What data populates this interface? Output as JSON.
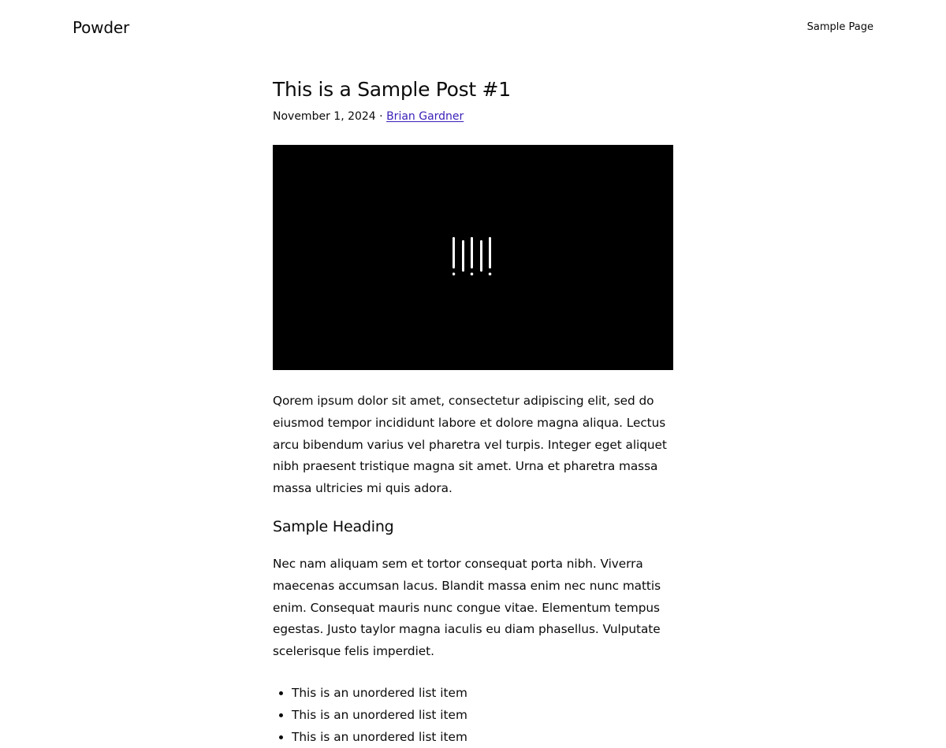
{
  "header": {
    "site_title": "Powder",
    "nav": [
      {
        "label": "Sample Page"
      }
    ]
  },
  "post": {
    "title": "This is a Sample Post #1",
    "date": "November 1, 2024",
    "separator": "·",
    "author": "Brian Gardner",
    "featured_image": {
      "icon": "barcode-logo-icon"
    },
    "paragraph_1": "Qorem ipsum dolor sit amet, consectetur adipiscing elit, sed do eiusmod tempor incididunt labore et dolore magna aliqua. Lectus arcu bibendum varius vel pharetra vel turpis. Integer eget aliquet nibh praesent tristique magna sit amet. Urna et pharetra massa massa ultricies mi quis adora.",
    "heading": "Sample Heading",
    "paragraph_2": "Nec nam aliquam sem et tortor consequat porta nibh. Viverra maecenas accumsan lacus. Blandit massa enim nec nunc mattis enim. Consequat mauris nunc congue vitae. Elementum tempus egestas. Justo taylor magna iaculis eu diam phasellus. Vulputate scelerisque felis imperdiet.",
    "list_items": [
      "This is an unordered list item",
      "This is an unordered list item",
      "This is an unordered list item"
    ]
  },
  "colors": {
    "link": "#3b1fb8",
    "text": "#0a0a0a",
    "image_bg": "#000000"
  }
}
